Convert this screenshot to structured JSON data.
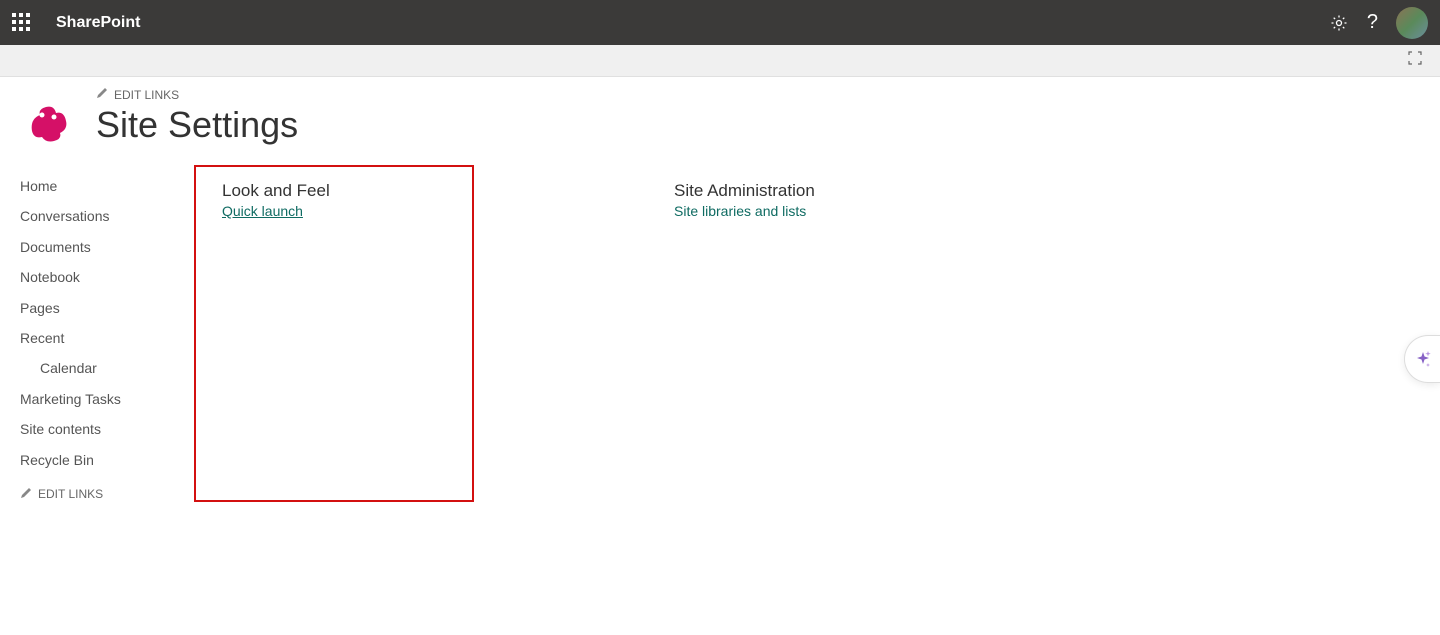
{
  "header": {
    "app_name": "SharePoint"
  },
  "page": {
    "edit_links_label": "EDIT LINKS",
    "title": "Site Settings"
  },
  "nav": {
    "items": [
      {
        "label": "Home",
        "indent": false
      },
      {
        "label": "Conversations",
        "indent": false
      },
      {
        "label": "Documents",
        "indent": false
      },
      {
        "label": "Notebook",
        "indent": false
      },
      {
        "label": "Pages",
        "indent": false
      },
      {
        "label": "Recent",
        "indent": false
      },
      {
        "label": "Calendar",
        "indent": true
      },
      {
        "label": "Marketing Tasks",
        "indent": false
      },
      {
        "label": "Site contents",
        "indent": false
      },
      {
        "label": "Recycle Bin",
        "indent": false
      }
    ],
    "edit_links_label": "EDIT LINKS"
  },
  "settings": {
    "look_and_feel": {
      "heading": "Look and Feel",
      "links": [
        "Quick launch"
      ]
    },
    "site_administration": {
      "heading": "Site Administration",
      "links": [
        "Site libraries and lists"
      ]
    }
  },
  "colors": {
    "brand": "#d51067",
    "link": "#0f6b62",
    "highlight": "#d31010"
  }
}
